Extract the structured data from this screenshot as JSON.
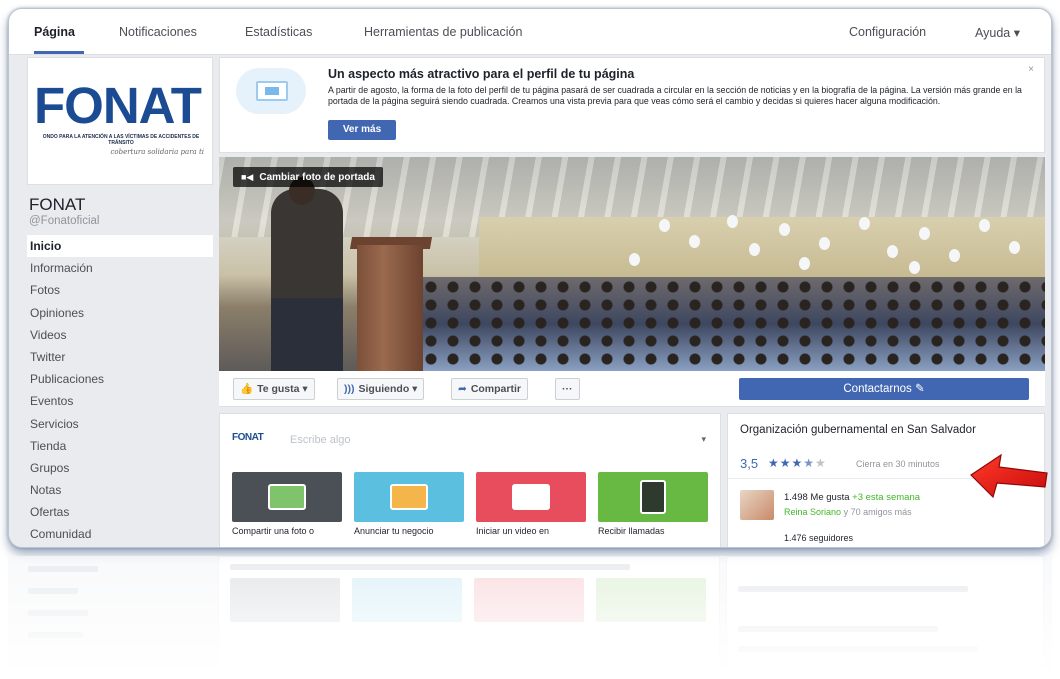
{
  "tabs": [
    {
      "label": "Página",
      "active": true
    },
    {
      "label": "Notificaciones"
    },
    {
      "label": "Estadísticas"
    },
    {
      "label": "Herramientas de publicación"
    }
  ],
  "top_right": {
    "settings": "Configuración",
    "help": "Ayuda ▾"
  },
  "logo": {
    "name": "FONAT",
    "subtitle": "ONDO PARA LA ATENCIÓN A LAS VÍCTIMAS DE ACCIDENTES DE TRÁNSITO",
    "slogan": "cobertura solidaria para ti"
  },
  "page": {
    "name": "FONAT",
    "handle": "@Fonatoficial"
  },
  "nav": [
    "Inicio",
    "Información",
    "Fotos",
    "Opiniones",
    "Videos",
    "Twitter",
    "Publicaciones",
    "Eventos",
    "Servicios",
    "Tienda",
    "Grupos",
    "Notas",
    "Ofertas",
    "Comunidad"
  ],
  "notice": {
    "title": "Un aspecto más atractivo para el perfil de tu página",
    "body": "A partir de agosto, la forma de la foto del perfil de tu página pasará de ser cuadrada a circular en la sección de noticias y en la biografía de la página. La versión más grande en la portada de la página seguirá siendo cuadrada. Creamos una vista previa para que veas cómo será el cambio y decidas si quieres hacer alguna modificación.",
    "button": "Ver más",
    "close": "×"
  },
  "cover": {
    "change_button": "Cambiar foto de portada"
  },
  "actions": {
    "like": "Te gusta ▾",
    "follow": "Siguiendo ▾",
    "share": "Compartir",
    "more": "···",
    "contact": "Contactarnos ✎"
  },
  "composer": {
    "logo": "FONAT",
    "placeholder": "Escribe algo",
    "audience": "▾",
    "tiles": [
      {
        "label": "Compartir una foto o",
        "color": "#4b4f56",
        "accent": "#7fc46b"
      },
      {
        "label": "Anunciar tu negocio",
        "color": "#5bc0e0",
        "accent": "#f4b54a"
      },
      {
        "label": "Iniciar un video en",
        "color": "#e84d5e",
        "accent": "#ffffff"
      },
      {
        "label": "Recibir llamadas",
        "color": "#68b944",
        "accent": "#2f3a2e"
      }
    ]
  },
  "about": {
    "category": "Organización gubernamental en San Salvador",
    "rating": "3,5",
    "hours": "Cierra en 30 minutos",
    "likes": "1.498 Me gusta",
    "likes_week": "+3 esta semana",
    "friend_name": "Reina Soriano",
    "friends_suffix": "y 70 amigos más",
    "followers": "1.476 seguidores"
  },
  "colors": {
    "accent": "#4267b2",
    "arrow": "#e8110f",
    "background": "#e9ebee"
  }
}
